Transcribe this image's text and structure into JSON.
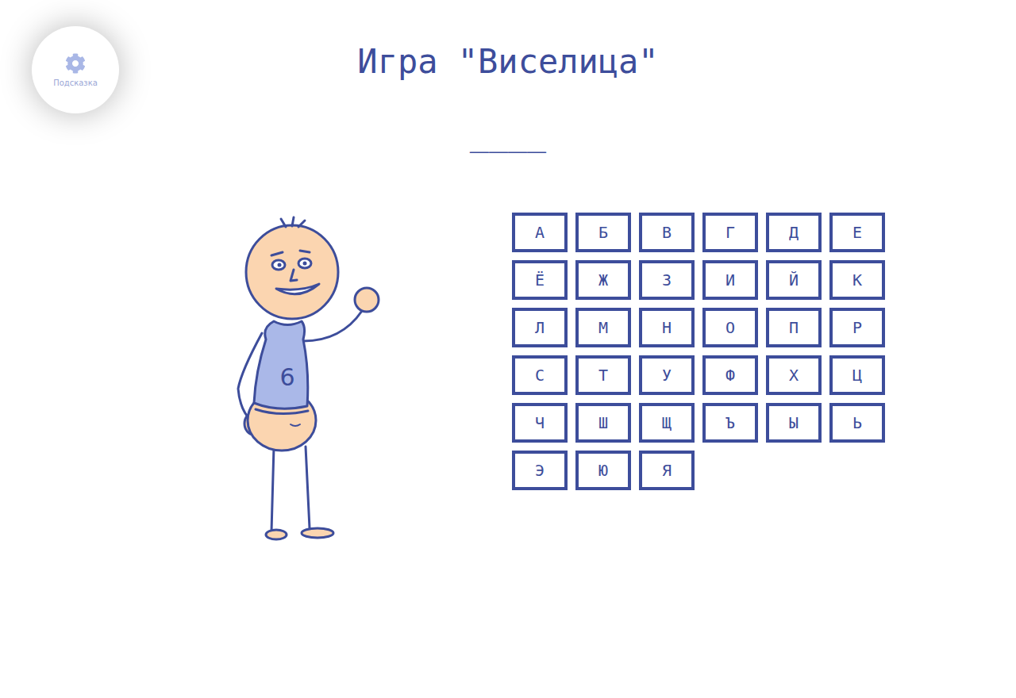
{
  "hint": {
    "label": "Подсказка"
  },
  "title": "Игра \"Виселица\"",
  "word": {
    "display": "____"
  },
  "figure": {
    "shirt_number": "6"
  },
  "letters": [
    "А",
    "Б",
    "В",
    "Г",
    "Д",
    "Е",
    "Ё",
    "Ж",
    "З",
    "И",
    "Й",
    "К",
    "Л",
    "М",
    "Н",
    "О",
    "П",
    "Р",
    "С",
    "Т",
    "У",
    "Ф",
    "Х",
    "Ц",
    "Ч",
    "Ш",
    "Щ",
    "Ъ",
    "Ы",
    "Ь",
    "Э",
    "Ю",
    "Я"
  ]
}
